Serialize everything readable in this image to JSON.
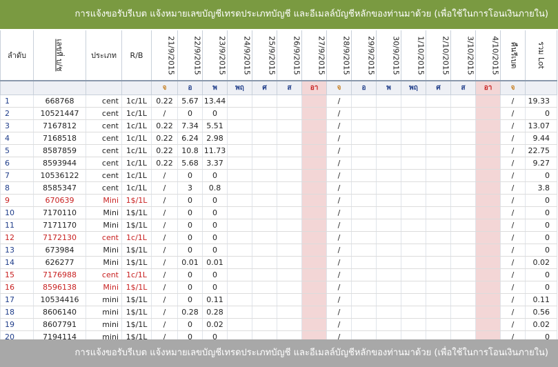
{
  "banner": {
    "top": "การแจ้งขอรับรีเบต  แจ้งหมายเลขบัญชีเทรดประเภทบัญชี และอีเมลล์บัญชีหลักของท่านมาด้วย  (เพื่อใช้ในการโอนเงินภายใน)",
    "bottom": "การแจ้งขอรับรีเบต  แจ้งหมายเลขบัญชีเทรดประเภทบัญชี และอีเมลล์บัญชีหลักของท่านมาด้วย  (เพื่อใช้ในการโอนเงินภายใน)"
  },
  "headers": {
    "index": "ลำดับ",
    "account": "เลขที่ บ/ช",
    "type": "ประเภท",
    "rb": "R/B",
    "dates": [
      "21/9/2015",
      "22/9/2015",
      "23/9/2015",
      "24/9/2015",
      "25/9/2015",
      "26/9/2015",
      "27/9/2015",
      "28/9/2015",
      "29/9/2015",
      "30/9/2015",
      "1/10/2015",
      "2/10/2015",
      "3/10/2015",
      "4/10/2015"
    ],
    "rebate": "คืนรีเบต",
    "total": "รวม Lot"
  },
  "days": [
    "จ",
    "อ",
    "พ",
    "พฤ",
    "ศ",
    "ส",
    "อา",
    "จ",
    "อ",
    "พ",
    "พฤ",
    "ศ",
    "ส",
    "อา",
    "จ"
  ],
  "colors": {
    "banner": "#7a9a41",
    "footer": "#a8a8a8",
    "holiday": "#f3d6d6",
    "red": "#c82020"
  },
  "rows": [
    {
      "n": "1",
      "acc": "668768",
      "type": "cent",
      "rb": "1c/1L",
      "d1": "0.22",
      "d2": "5.67",
      "d3": "13.44",
      "d8": "/",
      "reb": "/",
      "tot": "19.33"
    },
    {
      "n": "2",
      "acc": "10521447",
      "type": "cent",
      "rb": "1c/1L",
      "d1": "/",
      "d2": "0",
      "d3": "0",
      "d8": "/",
      "reb": "/",
      "tot": "0"
    },
    {
      "n": "3",
      "acc": "7167812",
      "type": "cent",
      "rb": "1c/1L",
      "d1": "0.22",
      "d2": "7.34",
      "d3": "5.51",
      "d8": "/",
      "reb": "/",
      "tot": "13.07"
    },
    {
      "n": "4",
      "acc": "7168518",
      "type": "cent",
      "rb": "1c/1L",
      "d1": "0.22",
      "d2": "6.24",
      "d3": "2.98",
      "d8": "/",
      "reb": "/",
      "tot": "9.44"
    },
    {
      "n": "5",
      "acc": "8587859",
      "type": "cent",
      "rb": "1c/1L",
      "d1": "0.22",
      "d2": "10.8",
      "d3": "11.73",
      "d8": "/",
      "reb": "/",
      "tot": "22.75"
    },
    {
      "n": "6",
      "acc": "8593944",
      "type": "cent",
      "rb": "1c/1L",
      "d1": "0.22",
      "d2": "5.68",
      "d3": "3.37",
      "d8": "/",
      "reb": "/",
      "tot": "9.27"
    },
    {
      "n": "7",
      "acc": "10536122",
      "type": "cent",
      "rb": "1c/1L",
      "d1": "/",
      "d2": "0",
      "d3": "0",
      "d8": "/",
      "reb": "/",
      "tot": "0"
    },
    {
      "n": "8",
      "acc": "8585347",
      "type": "cent",
      "rb": "1c/1L",
      "d1": "/",
      "d2": "3",
      "d3": "0.8",
      "d8": "/",
      "reb": "/",
      "tot": "3.8"
    },
    {
      "n": "9",
      "acc": "670639",
      "type": "Mini",
      "rb": "1$/1L",
      "d1": "/",
      "d2": "0",
      "d3": "0",
      "d8": "/",
      "reb": "/",
      "tot": "0",
      "red": true
    },
    {
      "n": "10",
      "acc": "7170110",
      "type": "Mini",
      "rb": "1$/1L",
      "d1": "/",
      "d2": "0",
      "d3": "0",
      "d8": "/",
      "reb": "/",
      "tot": "0"
    },
    {
      "n": "11",
      "acc": "7171170",
      "type": "Mini",
      "rb": "1$/1L",
      "d1": "/",
      "d2": "0",
      "d3": "0",
      "d8": "/",
      "reb": "/",
      "tot": "0"
    },
    {
      "n": "12",
      "acc": "7172130",
      "type": "cent",
      "rb": "1c/1L",
      "d1": "/",
      "d2": "0",
      "d3": "0",
      "d8": "/",
      "reb": "/",
      "tot": "0",
      "red": true
    },
    {
      "n": "13",
      "acc": "673984",
      "type": "Mini",
      "rb": "1$/1L",
      "d1": "/",
      "d2": "0",
      "d3": "0",
      "d8": "/",
      "reb": "/",
      "tot": "0"
    },
    {
      "n": "14",
      "acc": "626277",
      "type": "Mini",
      "rb": "1$/1L",
      "d1": "/",
      "d2": "0.01",
      "d3": "0.01",
      "d8": "/",
      "reb": "/",
      "tot": "0.02"
    },
    {
      "n": "15",
      "acc": "7176988",
      "type": "cent",
      "rb": "1c/1L",
      "d1": "/",
      "d2": "0",
      "d3": "0",
      "d8": "/",
      "reb": "/",
      "tot": "0",
      "red": true
    },
    {
      "n": "16",
      "acc": "8596138",
      "type": "Mini",
      "rb": "1$/1L",
      "d1": "/",
      "d2": "0",
      "d3": "0",
      "d8": "/",
      "reb": "/",
      "tot": "0",
      "red": true
    },
    {
      "n": "17",
      "acc": "10534416",
      "type": "mini",
      "rb": "1$/1L",
      "d1": "/",
      "d2": "0",
      "d3": "0.11",
      "d8": "/",
      "reb": "/",
      "tot": "0.11"
    },
    {
      "n": "18",
      "acc": "8606140",
      "type": "mini",
      "rb": "1$/1L",
      "d1": "/",
      "d2": "0.28",
      "d3": "0.28",
      "d8": "/",
      "reb": "/",
      "tot": "0.56"
    },
    {
      "n": "19",
      "acc": "8607791",
      "type": "mini",
      "rb": "1$/1L",
      "d1": "/",
      "d2": "0",
      "d3": "0.02",
      "d8": "/",
      "reb": "/",
      "tot": "0.02"
    },
    {
      "n": "20",
      "acc": "7194114",
      "type": "mini",
      "rb": "1$/1L",
      "d1": "/",
      "d2": "0",
      "d3": "0",
      "d8": "/",
      "reb": "/",
      "tot": "0"
    }
  ]
}
